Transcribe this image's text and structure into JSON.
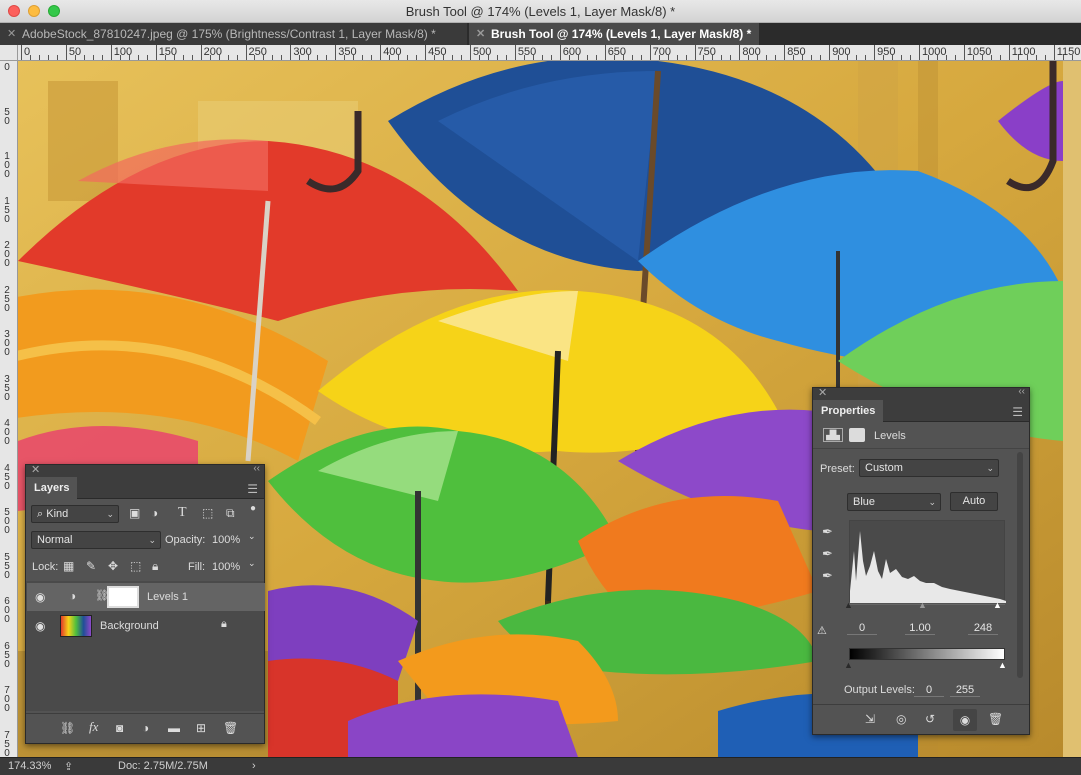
{
  "window": {
    "title": "Brush Tool @ 174% (Levels 1, Layer Mask/8) *"
  },
  "tabs": [
    {
      "label": "AdobeStock_87810247.jpeg @ 175% (Brightness/Contrast 1, Layer Mask/8) *",
      "active": false
    },
    {
      "label": "Brush Tool @ 174% (Levels 1, Layer Mask/8) *",
      "active": true
    }
  ],
  "ruler": {
    "h_labels": [
      "0",
      "50",
      "100",
      "150",
      "200",
      "250",
      "300",
      "350",
      "400",
      "450",
      "500",
      "550",
      "600",
      "650",
      "700",
      "750",
      "800",
      "850",
      "900",
      "950",
      "1000",
      "1050",
      "1100",
      "1150"
    ],
    "v_labels": [
      "0",
      "5 0",
      "1 0 0",
      "1 5 0",
      "2 0 0",
      "2 5 0",
      "3 0 0",
      "3 5 0",
      "4 0 0",
      "4 5 0",
      "5 0 0",
      "5 5 0",
      "6 0 0",
      "6 5 0",
      "7 0 0",
      "7 5 0"
    ]
  },
  "layers_panel": {
    "title": "Layers",
    "filter_kind": "Kind",
    "blend_mode": "Normal",
    "opacity_label": "Opacity:",
    "opacity_value": "100%",
    "lock_label": "Lock:",
    "fill_label": "Fill:",
    "fill_value": "100%",
    "layers": [
      {
        "name": "Levels 1",
        "selected": true
      },
      {
        "name": "Background",
        "selected": false,
        "locked": true
      }
    ],
    "footer_fx": "fx"
  },
  "properties_panel": {
    "title": "Properties",
    "subtitle": "Levels",
    "preset_label": "Preset:",
    "preset_value": "Custom",
    "channel_value": "Blue",
    "auto_label": "Auto",
    "input_black": "0",
    "input_gamma": "1.00",
    "input_white": "248",
    "output_label": "Output Levels:",
    "output_black": "0",
    "output_white": "255"
  },
  "status": {
    "zoom": "174.33%",
    "doc": "Doc: 2.75M/2.75M",
    "arrow": "›"
  },
  "colors": {
    "accent_red": "#e0312a",
    "accent_blue": "#1f4f96",
    "accent_yellow": "#f5c518",
    "accent_green": "#5ac84a"
  }
}
